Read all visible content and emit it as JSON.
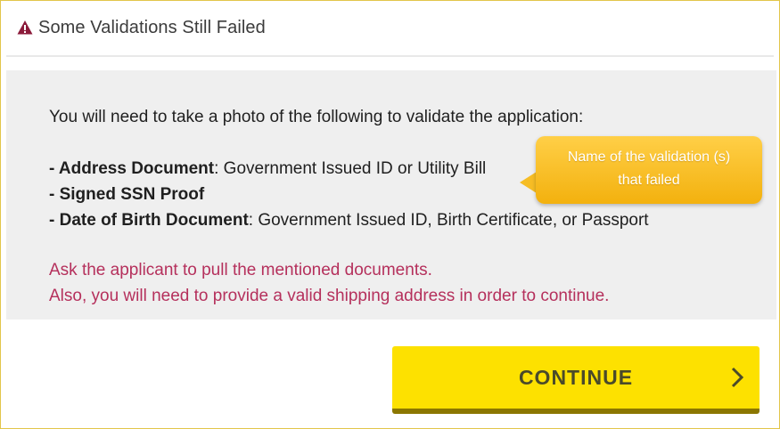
{
  "header": {
    "title": "Some Validations Still Failed",
    "icon": "warning-triangle-icon",
    "icon_color": "#8b1a3a"
  },
  "panel": {
    "intro": "You will need to take a photo of the following to validate the application:",
    "items": [
      {
        "name": "- Address Document",
        "detail": ": Government Issued ID or Utility Bill"
      },
      {
        "name": "- Signed SSN Proof",
        "detail": ""
      },
      {
        "name": "- Date of Birth Document",
        "detail": ": Government Issued ID, Birth Certificate, or Passport"
      }
    ],
    "note_lines": [
      "Ask the applicant to pull the mentioned documents.",
      "Also, you will need to provide a valid shipping address in order to continue."
    ],
    "note_color": "#b5305c"
  },
  "tooltip": {
    "lines": [
      "Name of the validation (s)",
      "that failed"
    ],
    "color": "#f6bd25"
  },
  "continue_button": {
    "label": "CONTINUE",
    "icon": "chevron-right-icon",
    "color": "#fde100"
  }
}
